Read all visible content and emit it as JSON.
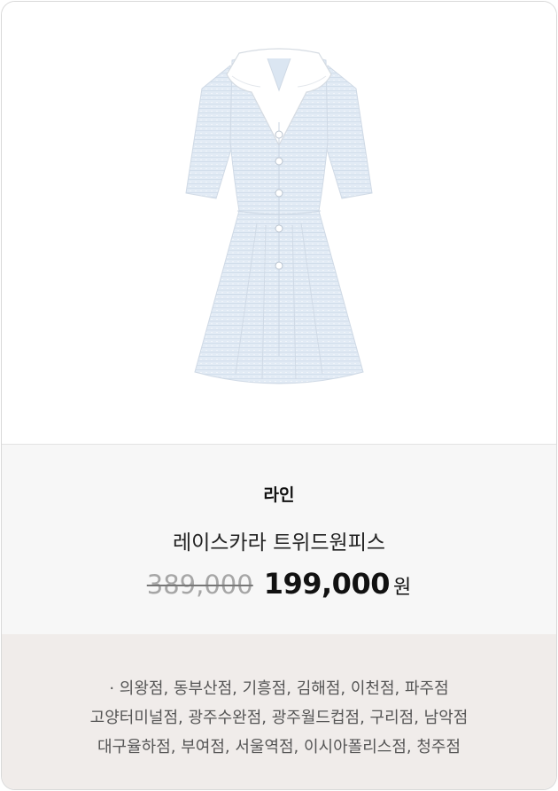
{
  "product": {
    "brand": "라인",
    "name": "레이스카라 트위드원피스",
    "original_price": "389,000",
    "sale_price": "199,000",
    "currency": "원",
    "image": "light-blue-tweed-dress-with-lace-collar"
  },
  "stores": {
    "lines": [
      "· 의왕점, 동부산점, 기흥점, 김해점, 이천점, 파주점",
      "고양터미널점, 광주수완점, 광주월드컵점, 구리점, 남악점",
      "대구율하점, 부여점, 서울역점, 이시아폴리스점, 청주점"
    ]
  },
  "colors": {
    "dress": "#e2ebf5",
    "collar": "#ffffff",
    "info_bg": "#f7f7f7",
    "stores_bg": "#f0ecea"
  }
}
